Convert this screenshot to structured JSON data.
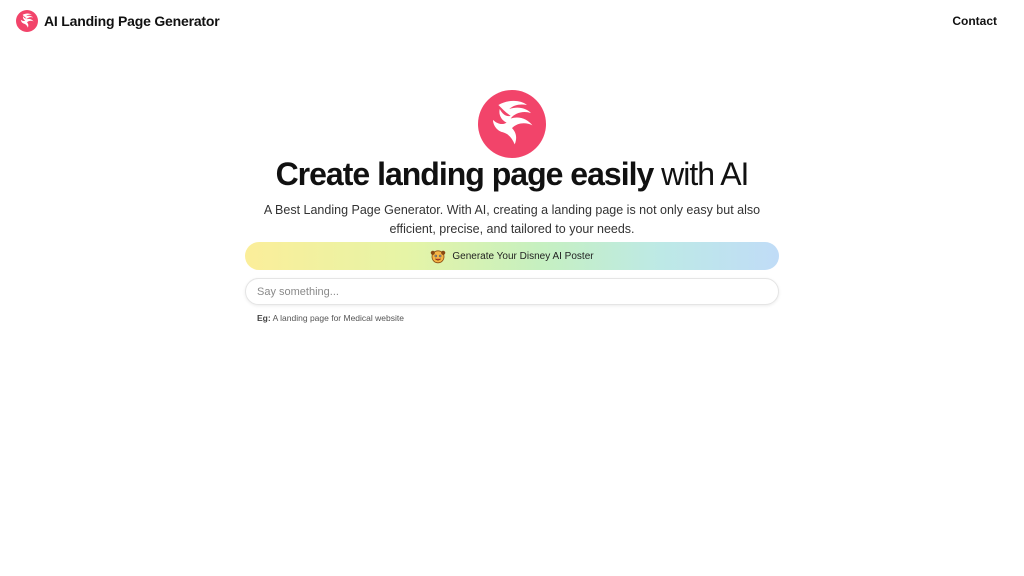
{
  "header": {
    "brand_name": "AI Landing Page Generator",
    "contact_label": "Contact"
  },
  "hero": {
    "title_bold": "Create landing page easily",
    "title_light": "with AI",
    "subtitle": "A Best Landing Page Generator. With AI, creating a landing page is not only easy but also efficient, precise, and tailored to your needs."
  },
  "promo": {
    "label": "Generate Your Disney AI Poster",
    "icon": "cartoon-face-icon"
  },
  "prompt": {
    "placeholder": "Say something...",
    "value": "",
    "example_label": "Eg:",
    "example_text": "A landing page for Medical website"
  },
  "colors": {
    "brand": "#f2446a",
    "text": "#111111",
    "banner_start": "#fbee9a",
    "banner_mid": "#c6f0c0",
    "banner_end": "#c0dcf7"
  }
}
